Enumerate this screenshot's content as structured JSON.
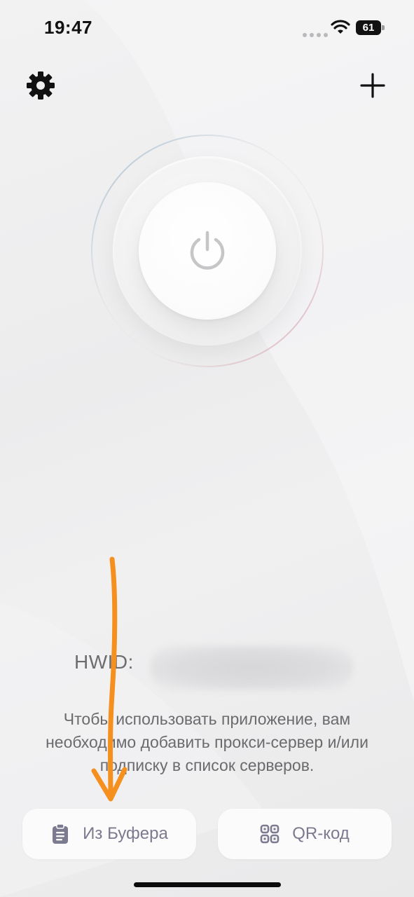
{
  "status_bar": {
    "time": "19:47",
    "battery_level": "61",
    "icons": [
      "cellular-dots-icon",
      "wifi-icon",
      "battery-icon"
    ]
  },
  "header": {
    "settings_icon": "gear-icon",
    "add_icon": "plus-icon"
  },
  "power": {
    "icon": "power-icon",
    "ring_colors": [
      "#9fb8c9",
      "#d79aa4"
    ]
  },
  "hwid": {
    "label": "HWID:"
  },
  "info": {
    "message": "Чтобы использовать приложение, вам необходимо добавить прокси-сервер и/или подписку в список серверов."
  },
  "actions": {
    "clipboard_label": "Из Буфера",
    "clipboard_icon": "clipboard-icon",
    "qr_label": "QR-код",
    "qr_icon": "qr-code-icon",
    "accent_color": "#7c7a8e"
  },
  "annotation": {
    "arrow_color": "#f5901e",
    "arrow_icon": "arrow-down-icon"
  }
}
